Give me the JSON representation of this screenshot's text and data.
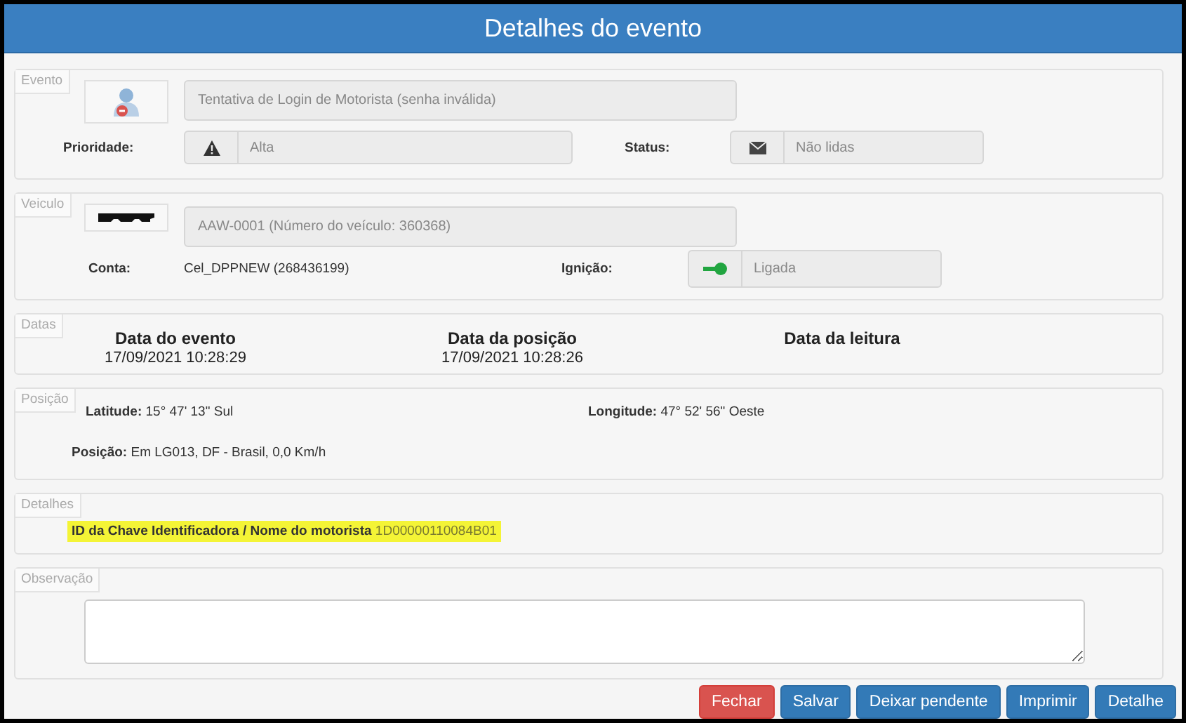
{
  "window": {
    "title": "Detalhes do evento"
  },
  "evento": {
    "legend": "Evento",
    "description": "Tentativa de Login de Motorista (senha inválida)",
    "priority": {
      "label": "Prioridade:",
      "value": "Alta"
    },
    "status": {
      "label": "Status:",
      "value": "Não lidas"
    }
  },
  "veiculo": {
    "legend": "Veiculo",
    "description": "AAW-0001 (Número do veículo: 360368)",
    "account": {
      "label": "Conta:",
      "value": "Cel_DPPNEW (268436199)"
    },
    "ignition": {
      "label": "Ignição:",
      "value": "Ligada",
      "on": true
    }
  },
  "datas": {
    "legend": "Datas",
    "items": [
      {
        "label": "Data do evento",
        "value": "17/09/2021 10:28:29"
      },
      {
        "label": "Data da posição",
        "value": "17/09/2021 10:28:26"
      },
      {
        "label": "Data da leitura"
      }
    ]
  },
  "posicao": {
    "legend": "Posição",
    "latitude": {
      "label": "Latitude:",
      "value": "15° 47' 13\" Sul"
    },
    "longitude": {
      "label": "Longitude:",
      "value": "47° 52' 56\" Oeste"
    },
    "position": {
      "label": "Posição:",
      "value": "Em LG013, DF - Brasil, 0,0 Km/h"
    }
  },
  "detalhes": {
    "legend": "Detalhes",
    "fields": [
      {
        "label": "ID da Chave Identificadora / Nome do motorista",
        "value": "1D00000110084B01",
        "highlighted": true
      }
    ]
  },
  "observacao": {
    "legend": "Observação"
  },
  "buttons": [
    {
      "label": "Fechar",
      "kind": "danger"
    },
    {
      "label": "Salvar",
      "kind": "primary"
    },
    {
      "label": "Deixar pendente",
      "kind": "primary"
    },
    {
      "label": "Imprimir",
      "kind": "primary"
    },
    {
      "label": "Detalhe",
      "kind": "primary"
    }
  ]
}
